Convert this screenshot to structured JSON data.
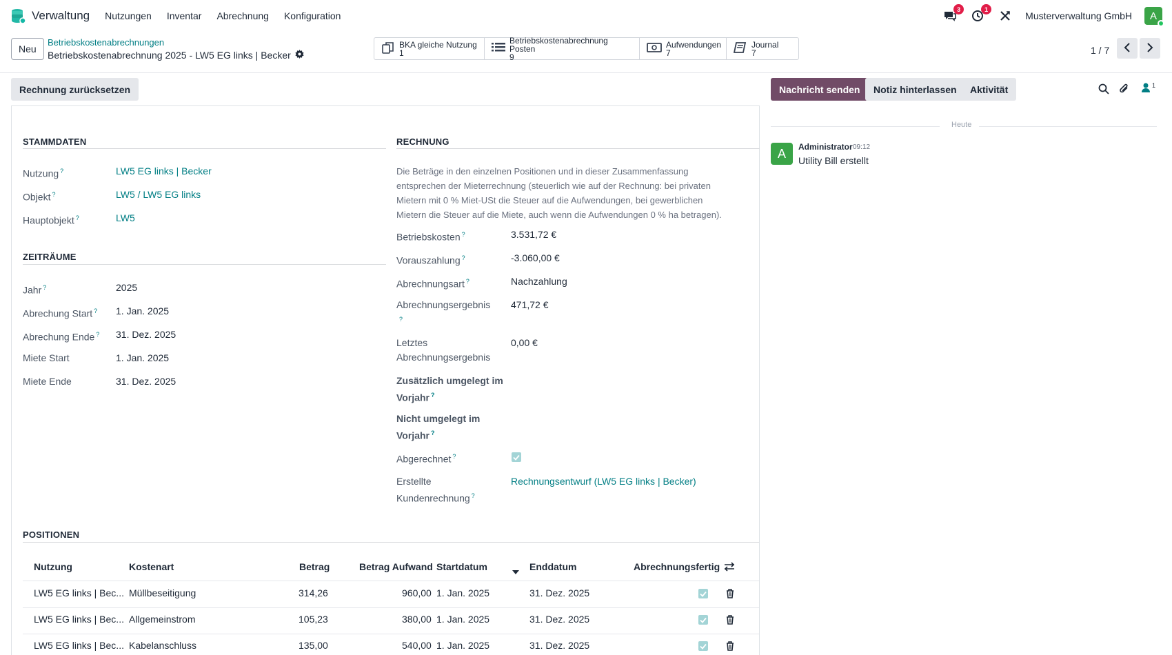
{
  "navbar": {
    "app_name": "Verwaltung",
    "menu": [
      "Nutzungen",
      "Inventar",
      "Abrechnung",
      "Konfiguration"
    ],
    "messages_badge": "3",
    "activity_badge": "1",
    "company": "Musterverwaltung GmbH",
    "avatar_letter": "A"
  },
  "control": {
    "new_label": "Neu",
    "breadcrumb": "Betriebskostenabrechnungen",
    "record_title": "Betriebskostenabrechnung 2025 - LW5 EG links | Becker",
    "smart_buttons": [
      {
        "label": "BKA gleiche Nutzung",
        "count": "1",
        "icon": "copy-icon"
      },
      {
        "label": "Betriebskostenabrechnung Posten",
        "count": "9",
        "icon": "list-icon"
      },
      {
        "label": "Aufwendungen",
        "count": "7",
        "icon": "money-icon"
      },
      {
        "label": "Journal",
        "count": "7",
        "icon": "book-icon"
      }
    ],
    "pager": "1 / 7"
  },
  "statusbar": {
    "reset_label": "Rechnung zurücksetzen"
  },
  "chatter_buttons": {
    "send": "Nachricht senden",
    "note": "Notiz hinterlassen",
    "activity": "Aktivität",
    "followers_count": "1"
  },
  "stammdaten": {
    "title": "STAMMDATEN",
    "nutzung_label": "Nutzung",
    "nutzung_value": "LW5 EG links | Becker",
    "objekt_label": "Objekt",
    "objekt_value": "LW5 / LW5 EG links",
    "hauptobjekt_label": "Hauptobjekt",
    "hauptobjekt_value": "LW5"
  },
  "zeitraeume": {
    "title": "ZEITRÄUME",
    "jahr_label": "Jahr",
    "jahr_value": "2025",
    "abr_start_label": "Abrechung Start",
    "abr_start_value": "1. Jan. 2025",
    "abr_ende_label": "Abrechung Ende",
    "abr_ende_value": "31. Dez. 2025",
    "miete_start_label": "Miete Start",
    "miete_start_value": "1. Jan. 2025",
    "miete_ende_label": "Miete Ende",
    "miete_ende_value": "31. Dez. 2025"
  },
  "rechnung": {
    "title": "RECHNUNG",
    "note_line1": "Die Beträge in den einzelnen Positionen und in dieser Zusammenfassung",
    "note_line2": "entsprechen der Mieterrechnung (steuerlich wie auf der Rechnung: bei privaten",
    "note_line3": "Mietern mit 0 % Miet-USt die Steuer auf die Aufwendungen, bei gewerblichen",
    "note_line4": "Mietern die Steuer auf die Miete, auch wenn die Aufwendungen 0 % ha betragen).",
    "betriebskosten_label": "Betriebskosten",
    "betriebskosten_value": "3.531,72 €",
    "vorauszahlung_label": "Vorauszahlung",
    "vorauszahlung_value": "-3.060,00 €",
    "abrechnungsart_label": "Abrechnungsart",
    "abrechnungsart_value": "Nachzahlung",
    "ergebnis_label": "Abrechnungsergebnis",
    "ergebnis_value": "471,72 €",
    "letztes_label_1": "Letztes",
    "letztes_label_2": "Abrechnungsergebnis",
    "letztes_value": "0,00 €",
    "zusaetzlich_label_1": "Zusätzlich umgelegt im",
    "zusaetzlich_label_2": "Vorjahr",
    "nicht_label_1": "Nicht umgelegt im",
    "nicht_label_2": "Vorjahr",
    "abgerechnet_label": "Abgerechnet",
    "abgerechnet_checked": true,
    "kundenrechnung_label_1": "Erstellte",
    "kundenrechnung_label_2": "Kundenrechnung",
    "kundenrechnung_value": "Rechnungsentwurf (LW5 EG links | Becker)"
  },
  "positionen": {
    "title": "POSITIONEN",
    "headers": {
      "nutzung": "Nutzung",
      "kostenart": "Kostenart",
      "betrag": "Betrag",
      "betrag_aufwand": "Betrag Aufwand",
      "startdatum": "Startdatum",
      "enddatum": "Enddatum",
      "abrechnungsfertig": "Abrechnungsfertig"
    },
    "rows": [
      {
        "nutzung": "LW5 EG links | Bec...",
        "kostenart": "Müllbeseitigung",
        "betrag": "314,26",
        "aufwand": "960,00",
        "start": "1. Jan. 2025",
        "ende": "31. Dez. 2025"
      },
      {
        "nutzung": "LW5 EG links | Bec...",
        "kostenart": "Allgemeinstrom",
        "betrag": "105,23",
        "aufwand": "380,00",
        "start": "1. Jan. 2025",
        "ende": "31. Dez. 2025"
      },
      {
        "nutzung": "LW5 EG links | Bec...",
        "kostenart": "Kabelanschluss",
        "betrag": "135,00",
        "aufwand": "540,00",
        "start": "1. Jan. 2025",
        "ende": "31. Dez. 2025"
      }
    ]
  },
  "chatter": {
    "today": "Heute",
    "author": "Administrator",
    "time": "09:12",
    "body": "Utility Bill erstellt",
    "avatar_letter": "A"
  },
  "colors": {
    "link": "#017e84",
    "primary": "#714b67",
    "avatar": "#3aa447",
    "badge": "#e11d48"
  }
}
